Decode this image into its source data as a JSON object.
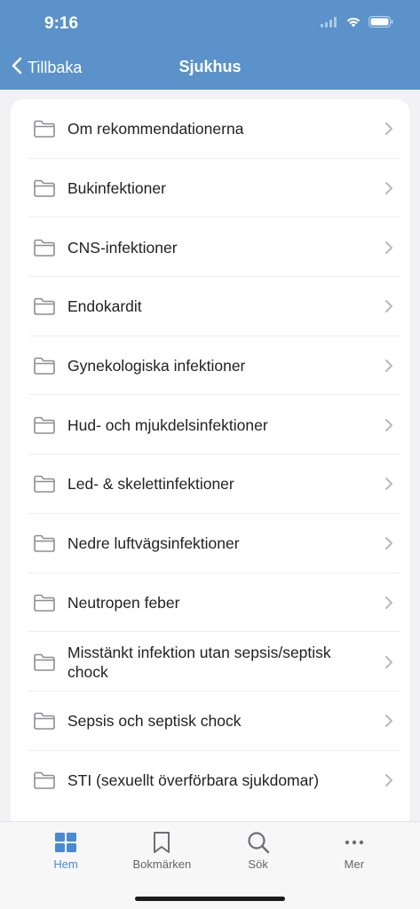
{
  "status": {
    "time": "9:16"
  },
  "nav": {
    "back_label": "Tillbaka",
    "title": "Sjukhus"
  },
  "list": {
    "items": [
      {
        "label": "Om rekommendationerna"
      },
      {
        "label": "Bukinfektioner"
      },
      {
        "label": "CNS-infektioner"
      },
      {
        "label": "Endokardit"
      },
      {
        "label": "Gynekologiska infektioner"
      },
      {
        "label": "Hud- och mjukdelsinfektioner"
      },
      {
        "label": "Led- & skelettinfektioner"
      },
      {
        "label": "Nedre luftvägsinfektioner"
      },
      {
        "label": "Neutropen feber"
      },
      {
        "label": "Misstänkt infektion utan sepsis/septisk chock"
      },
      {
        "label": "Sepsis och septisk chock"
      },
      {
        "label": "STI (sexuellt överförbara sjukdomar)"
      }
    ]
  },
  "tabbar": {
    "tabs": [
      {
        "label": "Hem",
        "icon": "grid-icon",
        "active": true
      },
      {
        "label": "Bokmärken",
        "icon": "bookmark-icon",
        "active": false
      },
      {
        "label": "Sök",
        "icon": "search-icon",
        "active": false
      },
      {
        "label": "Mer",
        "icon": "more-icon",
        "active": false
      }
    ]
  },
  "colors": {
    "header": "#5a92c9",
    "accent": "#4a8ad0",
    "icon_gray": "#8e8e93"
  }
}
